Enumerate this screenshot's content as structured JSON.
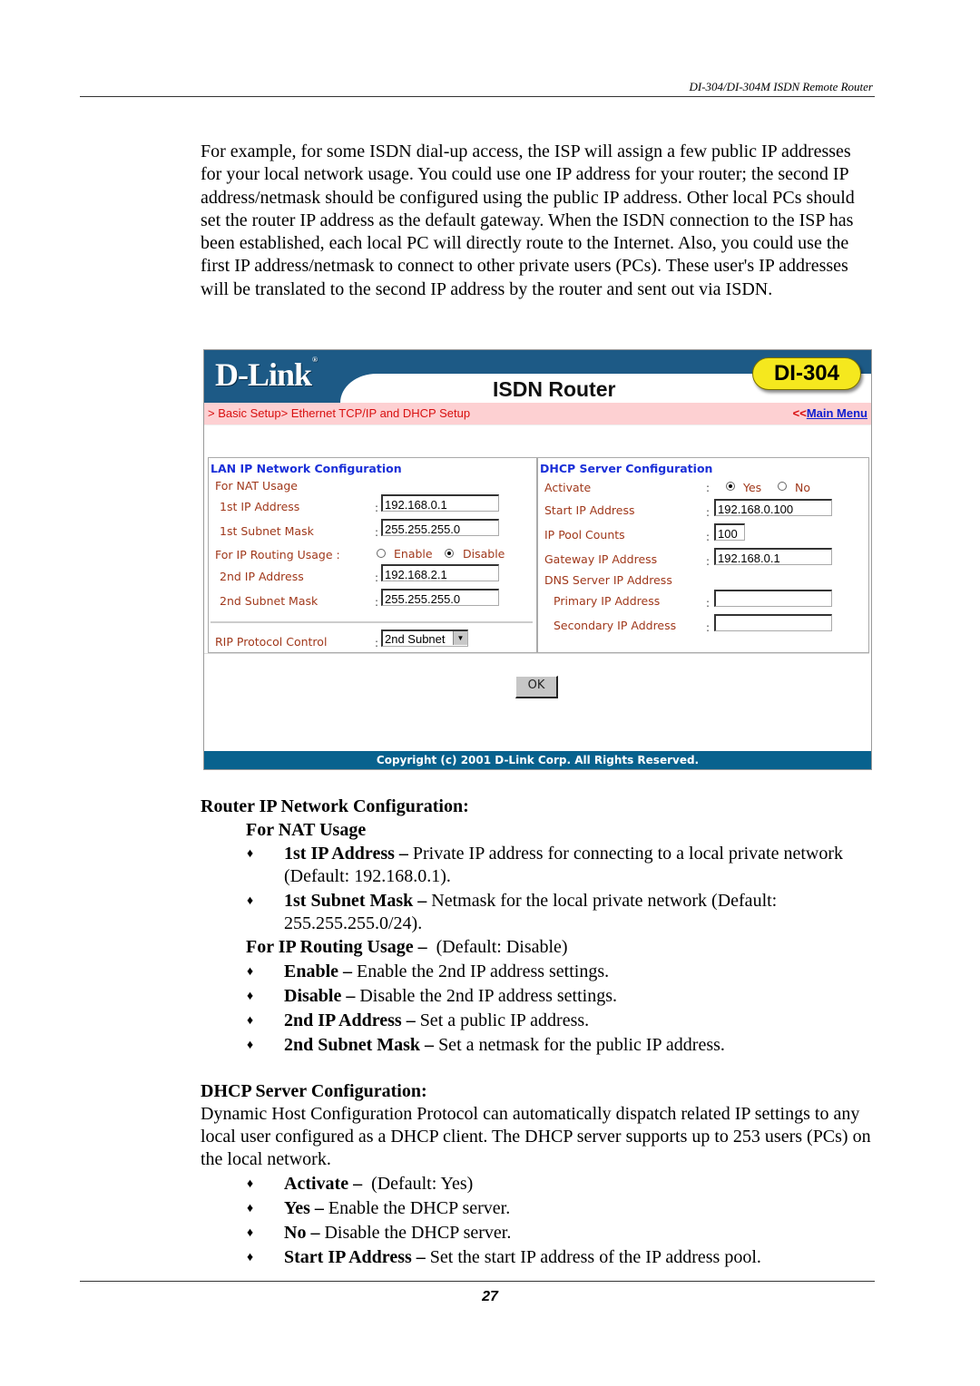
{
  "running_header": "DI-304/DI-304M ISDN Remote Router",
  "intro_paragraph": "For example, for some ISDN dial-up access, the ISP will assign a few public IP addresses for your local network usage. You could use one IP address for your router; the second IP address/netmask should be configured using the public IP address. Other local PCs should set the router IP address as the default gateway. When the ISDN connection to the ISP has been established, each local PC will directly route to the Internet. Also, you could use the first IP address/netmask to connect to other private users (PCs). These user's IP addresses will be translated to the second IP address by the router and sent out via ISDN.",
  "router_ui": {
    "banner": {
      "logo": "D-Link",
      "logo_mark": "®",
      "product_title": "ISDN Router",
      "model": "DI-304"
    },
    "breadcrumb": "> Basic Setup> Ethernet TCP/IP and DHCP Setup",
    "main_menu_prefix": "<<",
    "main_menu_link": "Main Menu",
    "lan": {
      "title": "LAN IP Network Configuration",
      "nat_usage_label": "For NAT Usage",
      "ip1_label": "1st IP Address",
      "ip1_value": "192.168.0.1",
      "mask1_label": "1st Subnet Mask",
      "mask1_value": "255.255.255.0",
      "routing_label": "For IP Routing Usage  :",
      "routing_enable_label": "Enable",
      "routing_disable_label": "Disable",
      "routing_selected": "Disable",
      "ip2_label": "2nd IP Address",
      "ip2_value": "192.168.2.1",
      "mask2_label": "2nd Subnet Mask",
      "mask2_value": "255.255.255.0",
      "rip_label": "RIP Protocol Control",
      "rip_value": "2nd Subnet",
      "colon": ":"
    },
    "dhcp": {
      "title": "DHCP Server Configuration",
      "activate_label": "Activate",
      "activate_yes_label": "Yes",
      "activate_no_label": "No",
      "activate_selected": "Yes",
      "start_ip_label": "Start IP Address",
      "start_ip_value": "192.168.0.100",
      "pool_label": "IP Pool Counts",
      "pool_value": "100",
      "gateway_label": "Gateway IP Address",
      "gateway_value": "192.168.0.1",
      "dns_label": "DNS Server IP Address",
      "primary_label": "Primary IP Address",
      "primary_value": "",
      "secondary_label": "Secondary IP Address",
      "secondary_value": "",
      "colon": ":"
    },
    "ok_button": "OK",
    "copyright": "Copyright (c) 2001 D-Link Corp. All Rights Reserved."
  },
  "router_section": {
    "heading": "Router IP Network Configuration:",
    "nat_heading": "For NAT Usage",
    "nat_bullets": [
      {
        "term": "1st IP Address –",
        "text": " Private IP address for connecting to a local private network (Default: 192.168.0.1)."
      },
      {
        "term": "1st Subnet Mask –",
        "text": " Netmask for the local private network (Default: 255.255.255.0/24)."
      }
    ],
    "routing_heading": "For IP Routing Usage –",
    "routing_default": "  (Default: Disable)",
    "routing_bullets": [
      {
        "term": "Enable –",
        "text": " Enable the 2nd IP address settings."
      },
      {
        "term": "Disable –",
        "text": " Disable the 2nd IP address settings."
      },
      {
        "term": "2nd IP Address –",
        "text": " Set a public IP address."
      },
      {
        "term": "2nd Subnet Mask –",
        "text": " Set a netmask for the public IP address."
      }
    ]
  },
  "dhcp_section": {
    "heading": "DHCP Server Configuration:",
    "paragraph": "Dynamic Host Configuration Protocol can automatically dispatch related IP settings to any local user configured as a DHCP client. The DHCP server supports up to 253 users (PCs) on the local network.",
    "bullets": [
      {
        "term": "Activate –",
        "text": "  (Default: Yes)"
      },
      {
        "term": "Yes –",
        "text": " Enable the DHCP server."
      },
      {
        "term": "No –",
        "text": " Disable the DHCP server."
      },
      {
        "term": "Start IP Address –",
        "text": " Set the start IP address of the IP address pool."
      }
    ],
    "bullet_glyph": "♦"
  },
  "page_number": "27"
}
